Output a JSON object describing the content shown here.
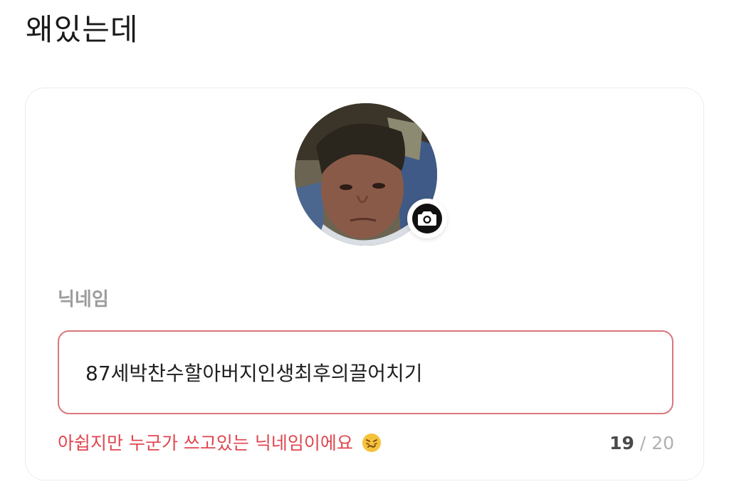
{
  "header": {
    "title": "왜있는데"
  },
  "profile": {
    "avatar_alt": "profile photo",
    "camera_icon": "camera-icon"
  },
  "nickname": {
    "label": "닉네임",
    "value": "87세박찬수할아버지인생최후의끌어치기",
    "error_message": "아쉽지만 누군가 쓰고있는 닉네임이에요",
    "error_emoji_icon": "worried-face-icon",
    "char_count": "19",
    "separator": " / ",
    "max_chars": "20"
  },
  "colors": {
    "error": "#e0464f",
    "input_border": "#d9767d",
    "label": "#9c9c9c",
    "counter_muted": "#b0b0b0"
  }
}
